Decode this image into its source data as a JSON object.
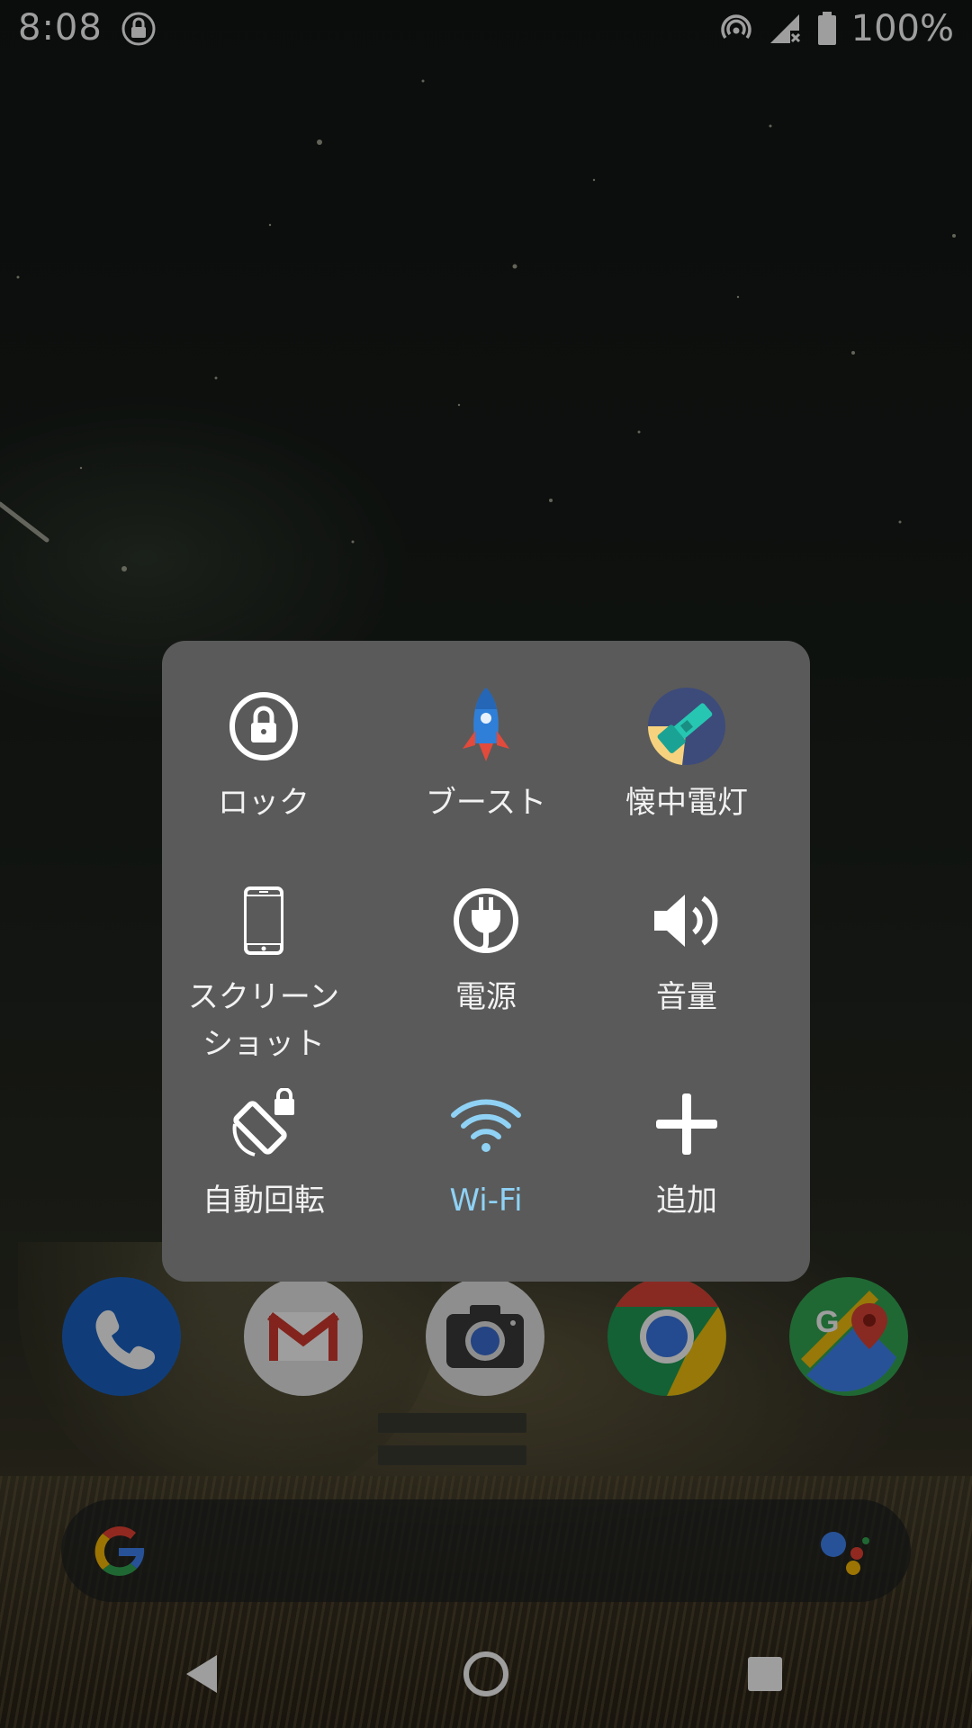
{
  "status_bar": {
    "time": "8:08",
    "battery_percent": "100%",
    "icons": [
      "screen-lock-icon",
      "hotspot-icon",
      "signal-off-icon",
      "battery-icon"
    ]
  },
  "quick_menu": {
    "items": [
      {
        "label": "ロック",
        "icon": "lock-icon"
      },
      {
        "label": "ブースト",
        "icon": "rocket-icon"
      },
      {
        "label": "懐中電灯",
        "icon": "flashlight-icon"
      },
      {
        "label": "スクリーン\nショット",
        "icon": "phone-screenshot-icon"
      },
      {
        "label": "電源",
        "icon": "power-plug-icon"
      },
      {
        "label": "音量",
        "icon": "volume-icon"
      },
      {
        "label": "自動回転",
        "icon": "auto-rotate-icon"
      },
      {
        "label": "Wi-Fi",
        "icon": "wifi-icon",
        "active": true
      },
      {
        "label": "追加",
        "icon": "plus-icon"
      }
    ],
    "active_color": "#8fd2f5"
  },
  "dock": {
    "apps": [
      "Phone",
      "Gmail",
      "Camera",
      "Chrome",
      "Maps"
    ]
  },
  "search_bar": {
    "icons": [
      "google-g-icon",
      "assistant-icon"
    ]
  },
  "nav_bar": {
    "buttons": [
      "back-icon",
      "home-icon",
      "recents-icon"
    ]
  }
}
